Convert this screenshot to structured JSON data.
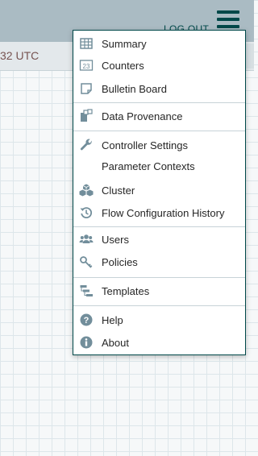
{
  "header": {
    "logout_label": "LOG OUT"
  },
  "status_bar": {
    "last_refreshed": "32 UTC"
  },
  "menu": {
    "items": [
      {
        "label": "Summary",
        "icon": "table-icon"
      },
      {
        "label": "Counters",
        "icon": "counter-icon"
      },
      {
        "label": "Bulletin Board",
        "icon": "sticky-note-icon"
      },
      {
        "label": "Data Provenance",
        "icon": "provenance-icon"
      },
      {
        "label": "Controller Settings",
        "icon": "wrench-icon"
      },
      {
        "label": "Parameter Contexts",
        "icon": ""
      },
      {
        "label": "Cluster",
        "icon": "cubes-icon"
      },
      {
        "label": "Flow Configuration History",
        "icon": "history-icon"
      },
      {
        "label": "Users",
        "icon": "users-icon"
      },
      {
        "label": "Policies",
        "icon": "key-icon"
      },
      {
        "label": "Templates",
        "icon": "templates-icon"
      },
      {
        "label": "Help",
        "icon": "question-circle-icon"
      },
      {
        "label": "About",
        "icon": "info-circle-icon"
      }
    ]
  },
  "colors": {
    "header_bg": "#aabbc3",
    "accent": "#004849",
    "icon_gray": "#728e9b",
    "time_color": "#775351"
  }
}
